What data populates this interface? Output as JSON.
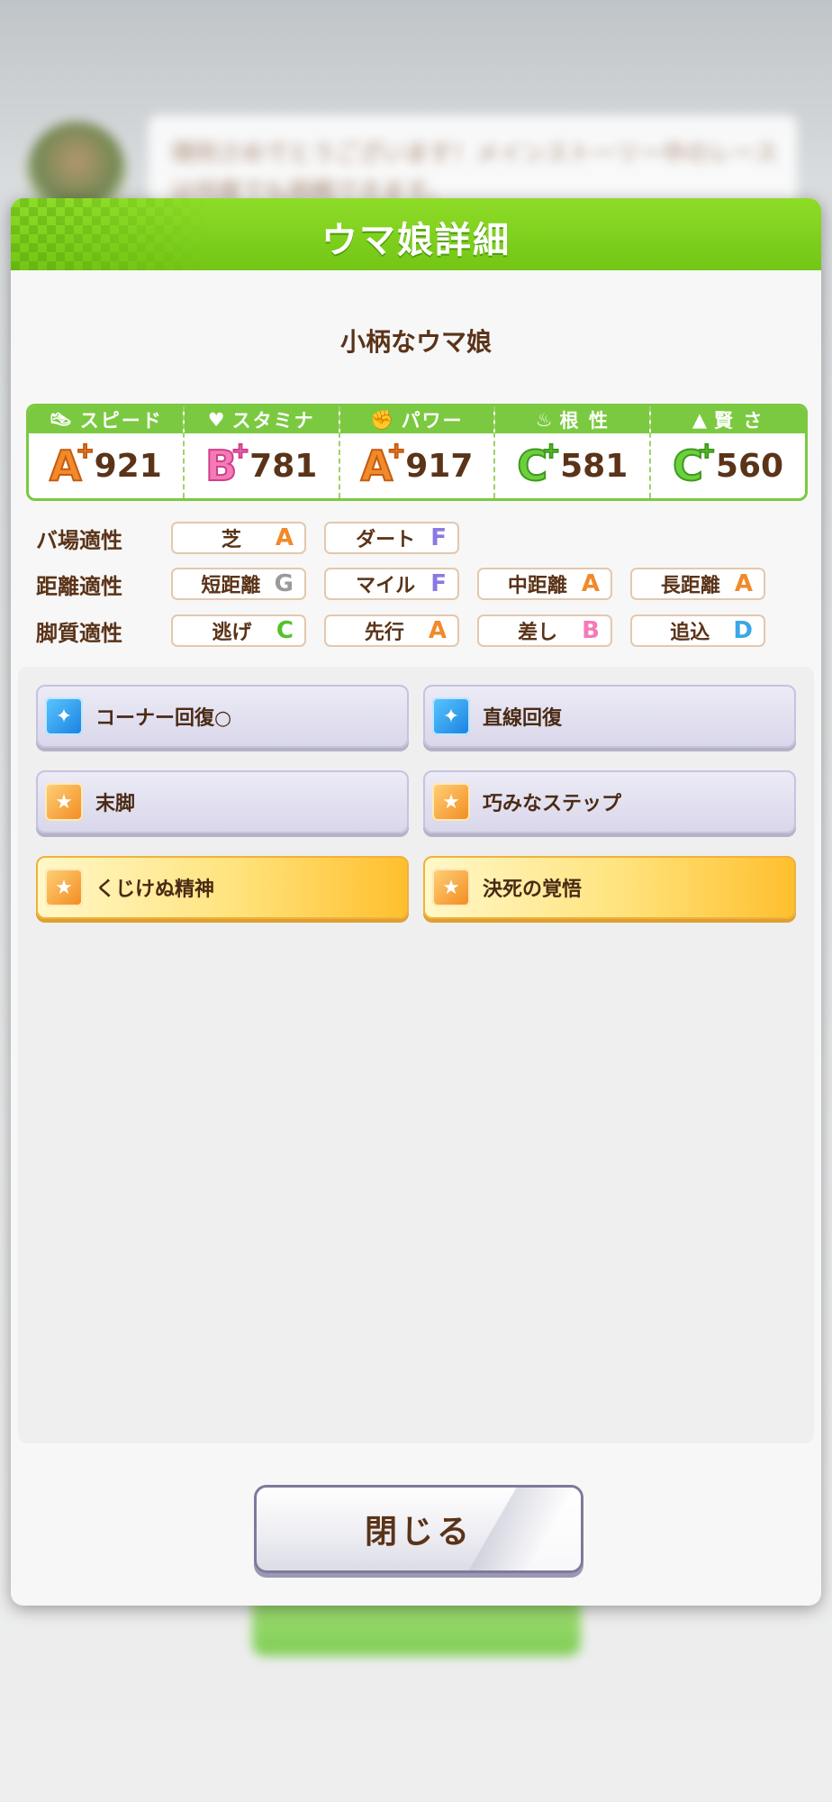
{
  "background": {
    "bubble_text": "得刑さめでとうございます！メインストーリー中のレースは何度でも挑戦できます。"
  },
  "dialog": {
    "title": "ウマ娘詳細",
    "character_name": "小柄なウマ娘",
    "close_label": "閉じる"
  },
  "stats": [
    {
      "label": "スピード",
      "icon": "shoe-icon",
      "grade": "A",
      "plus": "+",
      "value": "921"
    },
    {
      "label": "スタミナ",
      "icon": "heart-icon",
      "grade": "B",
      "plus": "+",
      "value": "781"
    },
    {
      "label": "パワー",
      "icon": "muscle-icon",
      "grade": "A",
      "plus": "+",
      "value": "917"
    },
    {
      "label": "根 性",
      "icon": "flame-icon",
      "grade": "C",
      "plus": "+",
      "value": "581"
    },
    {
      "label": "賢 さ",
      "icon": "graduation-cap-icon",
      "grade": "C",
      "plus": "+",
      "value": "560"
    }
  ],
  "aptitudes": {
    "track": {
      "label": "バ場適性",
      "items": [
        {
          "name": "芝",
          "grade": "A"
        },
        {
          "name": "ダート",
          "grade": "F"
        }
      ]
    },
    "distance": {
      "label": "距離適性",
      "items": [
        {
          "name": "短距離",
          "grade": "G"
        },
        {
          "name": "マイル",
          "grade": "F"
        },
        {
          "name": "中距離",
          "grade": "A"
        },
        {
          "name": "長距離",
          "grade": "A"
        }
      ]
    },
    "strategy": {
      "label": "脚質適性",
      "items": [
        {
          "name": "逃げ",
          "grade": "C"
        },
        {
          "name": "先行",
          "grade": "A"
        },
        {
          "name": "差し",
          "grade": "B"
        },
        {
          "name": "追込",
          "grade": "D"
        }
      ]
    }
  },
  "skills": [
    {
      "name": "コーナー回復○",
      "icon": "recovery-sparkle-icon",
      "style": "normal"
    },
    {
      "name": "直線回復",
      "icon": "recovery-sparkle-icon",
      "style": "normal"
    },
    {
      "name": "末脚",
      "icon": "running-figure-icon",
      "style": "normal"
    },
    {
      "name": "巧みなステップ",
      "icon": "running-figure-icon",
      "style": "normal"
    },
    {
      "name": "くじけぬ精神",
      "icon": "running-figure-icon",
      "style": "gold"
    },
    {
      "name": "決死の覚悟",
      "icon": "running-figure-icon",
      "style": "gold"
    }
  ],
  "colors": {
    "header_green": "#7bc940",
    "text_brown": "#5a3318",
    "grade_A": "#f08a2a",
    "grade_B": "#f57ab8",
    "grade_C": "#56c02c",
    "grade_D": "#3aa6e6",
    "grade_F": "#8b78e0",
    "grade_G": "#9a9a9a"
  }
}
